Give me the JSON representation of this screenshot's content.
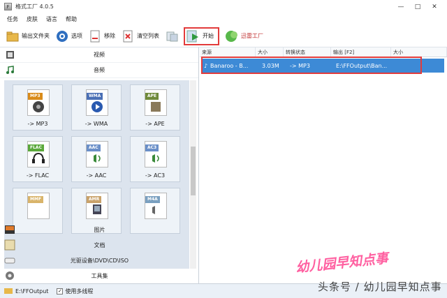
{
  "window": {
    "title": "格式工厂 4.0.5",
    "controls": [
      "—",
      "□",
      "✕"
    ]
  },
  "menu": [
    "任务",
    "皮肤",
    "语言",
    "帮助"
  ],
  "toolbar": {
    "output_folder": "输出文件夹",
    "options": "选项",
    "remove": "移除",
    "clear_list": "清空列表",
    "start": "开始",
    "stop": "迅雷工厂"
  },
  "sidebar": {
    "video": "视频",
    "audio": "音频",
    "formats": [
      {
        "tag": "MP3",
        "label": "-> MP3",
        "color": "#d98b1a"
      },
      {
        "tag": "WMA",
        "label": "-> WMA",
        "color": "#4a6fb5"
      },
      {
        "tag": "APE",
        "label": "-> APE",
        "color": "#6f8a3a"
      },
      {
        "tag": "FLAC",
        "label": "-> FLAC",
        "color": "#5aa83a"
      },
      {
        "tag": "AAC",
        "label": "-> AAC",
        "color": "#6a8fc8"
      },
      {
        "tag": "AC3",
        "label": "-> AC3",
        "color": "#6a8fc8"
      },
      {
        "tag": "MMF",
        "label": "",
        "color": "#b8b8b8"
      },
      {
        "tag": "AMR",
        "label": "",
        "color": "#c9a26a"
      },
      {
        "tag": "M4A",
        "label": "",
        "color": "#7aa0c0"
      }
    ],
    "picture": "图片",
    "document": "文档",
    "optical": "光驱设备\\DVD\\CD\\ISO",
    "toolbox": "工具集"
  },
  "table": {
    "headers": [
      "来源",
      "大小",
      "转换状态",
      "输出 [F2]",
      "大小"
    ],
    "rows": [
      {
        "source": "Banaroo - B...",
        "size": "3.03M",
        "status": "-> MP3",
        "output": "E:\\FFOutput\\Ban...",
        "out_size": ""
      }
    ]
  },
  "statusbar": {
    "path": "E:\\FFOutput",
    "multithread": "使用多线程"
  },
  "watermark": {
    "line1": "幼儿园早知点事",
    "line2": "头条号 / 幼儿园早知点事"
  },
  "colors": {
    "selection": "#3d8ad6",
    "highlight_box": "#e23b3b",
    "panel_bg": "#dce4ee"
  }
}
